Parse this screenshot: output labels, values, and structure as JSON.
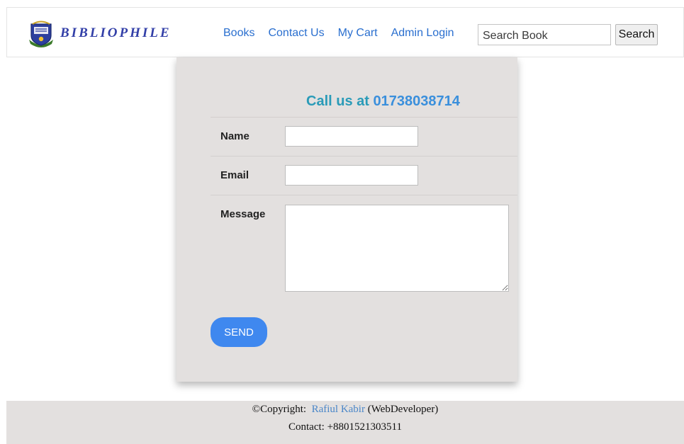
{
  "header": {
    "brand": "BIBLIOPHILE",
    "logo_icon": "university-crest-icon",
    "nav": [
      "Books",
      "Contact Us",
      "My Cart",
      "Admin Login"
    ],
    "search": {
      "placeholder": "Search Book",
      "button_label": "Search"
    }
  },
  "contact_form": {
    "heading_prefix": "Call us at",
    "phone": "01738038714",
    "fields": {
      "name_label": "Name",
      "email_label": "Email",
      "message_label": "Message"
    },
    "send_label": "SEND"
  },
  "footer": {
    "copyright_prefix": "©Copyright:",
    "author": "Rafiul Kabir",
    "author_role": "(WebDeveloper)",
    "contact": "Contact: +8801521303511"
  },
  "colors": {
    "brand": "#3340a8",
    "nav_link": "#2a6fcf",
    "heading": "#2a9bb8",
    "button": "#3f88ef",
    "card_bg": "#e3e0df"
  }
}
